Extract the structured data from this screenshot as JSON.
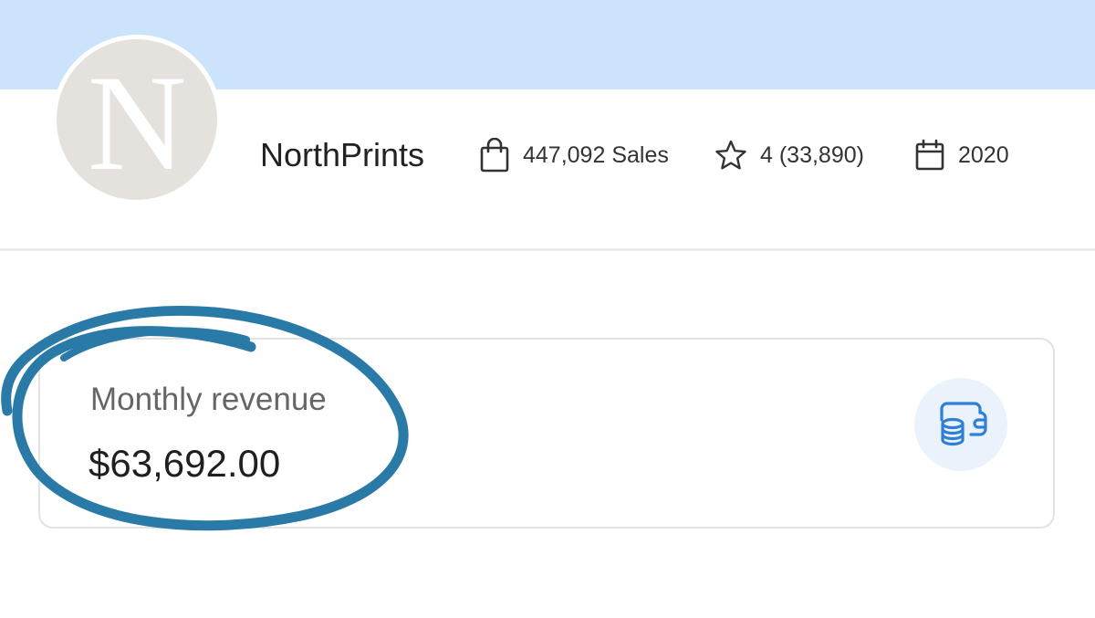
{
  "shop": {
    "avatar_letter": "N",
    "name": "NorthPrints"
  },
  "stats": {
    "sales": {
      "icon": "shopping-bag-icon",
      "text": "447,092 Sales"
    },
    "rating": {
      "icon": "star-icon",
      "text": "4 (33,890)"
    },
    "year": {
      "icon": "calendar-icon",
      "text": "2020"
    }
  },
  "revenue_card": {
    "label": "Monthly revenue",
    "value": "$63,692.00",
    "icon": "wallet-coins-icon"
  },
  "colors": {
    "banner": "#cbe4fb",
    "accent_scribble": "#2a7aa8",
    "icon_blue": "#2f7fd6",
    "icon_bg": "#eaf3fc"
  }
}
